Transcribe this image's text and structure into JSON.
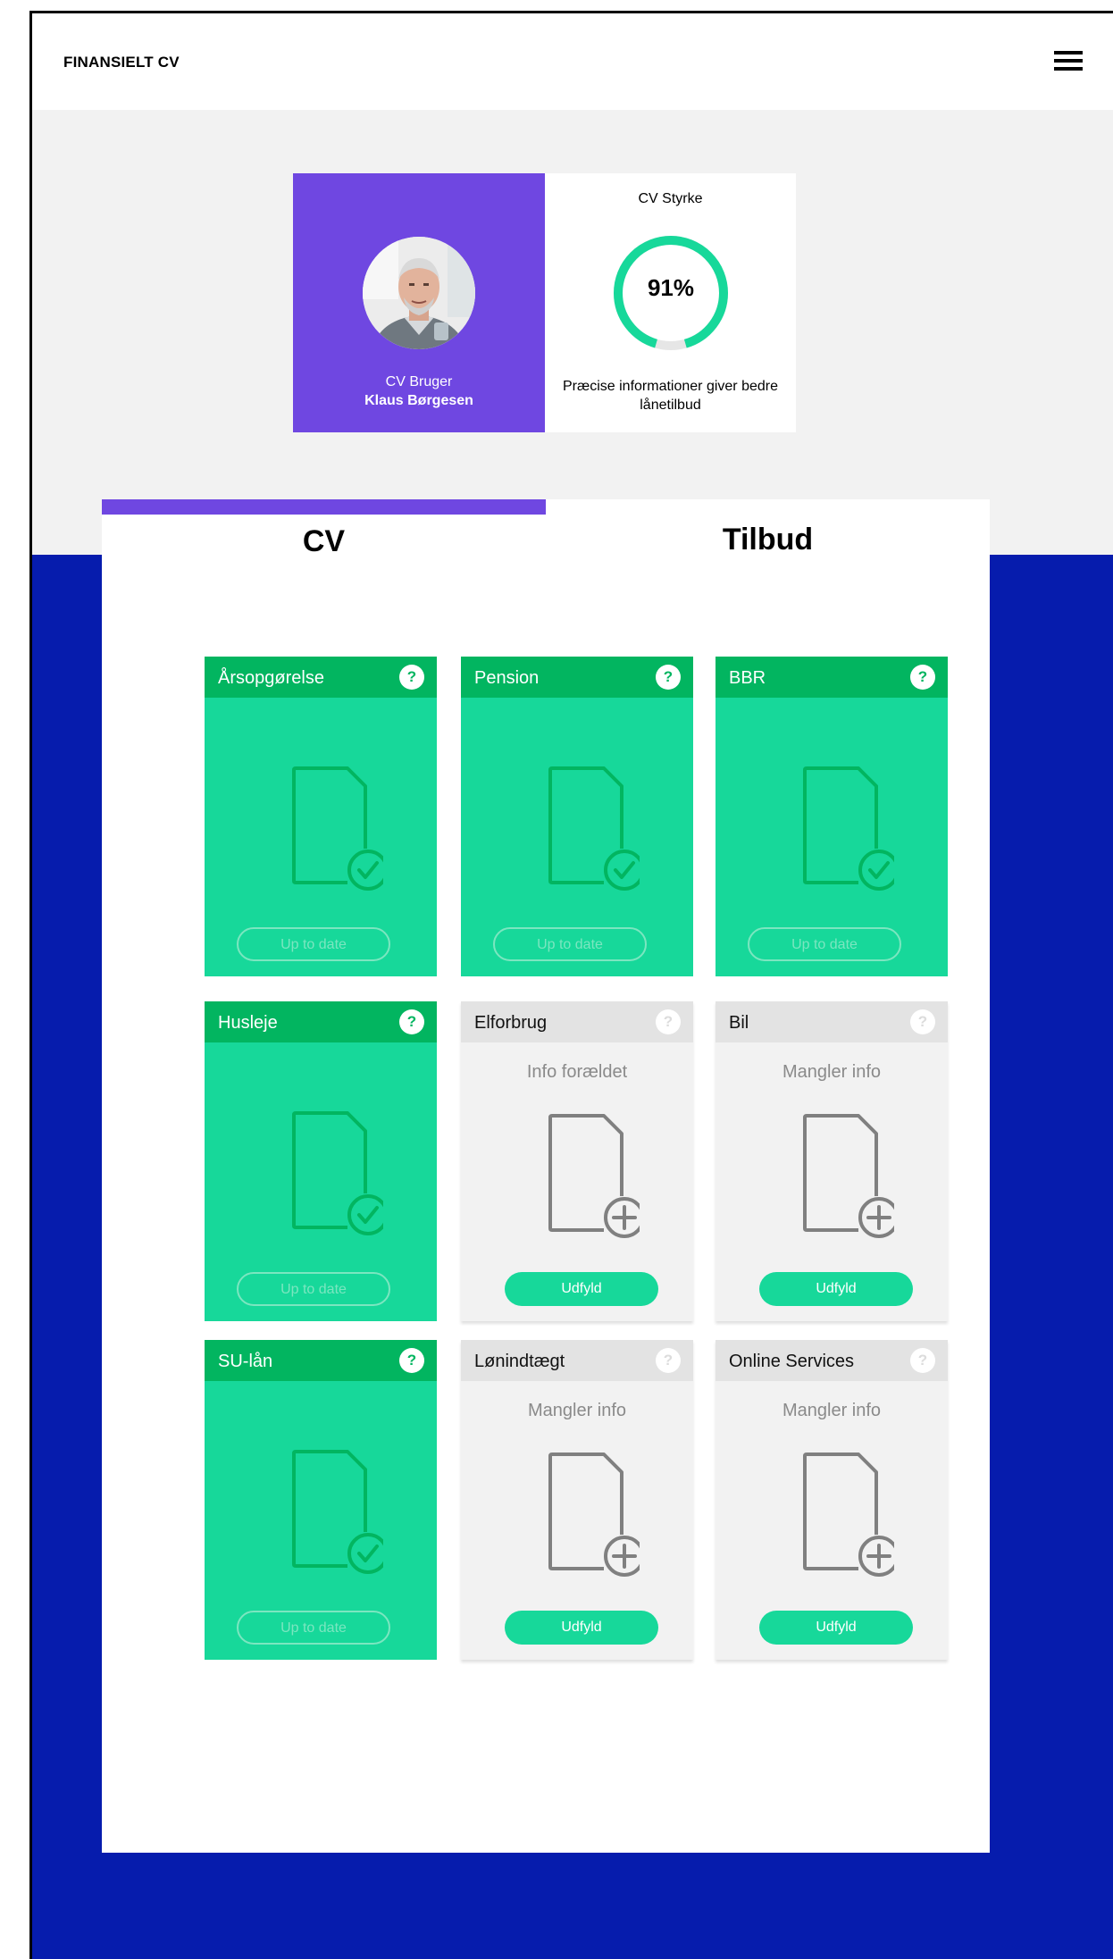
{
  "header": {
    "brand": "FINANSIELT CV",
    "menu_icon": "hamburger-icon"
  },
  "profile": {
    "role": "CV Bruger",
    "name": "Klaus Børgesen",
    "strength_title": "CV Styrke",
    "strength_value": "91%",
    "strength_fraction": 0.91,
    "note": "Præcise informationer giver bedre lånetilbud"
  },
  "tabs": [
    {
      "label": "CV",
      "active": true
    },
    {
      "label": "Tilbud",
      "active": false
    }
  ],
  "colors": {
    "purple": "#6f47e1",
    "navy": "#061cad",
    "green": "#17d89a",
    "dark_green": "#02b560",
    "grey": "#f2f2f2"
  },
  "cards": [
    {
      "title": "Årsopgørelse",
      "help": "?",
      "state": "complete",
      "icon": "document-check-icon",
      "button": "Up to date"
    },
    {
      "title": "Pension",
      "help": "?",
      "state": "complete",
      "icon": "document-check-icon",
      "button": "Up to date"
    },
    {
      "title": "BBR",
      "help": "?",
      "state": "complete",
      "icon": "document-check-icon",
      "button": "Up to date"
    },
    {
      "title": "Husleje",
      "help": "?",
      "state": "complete",
      "icon": "document-check-icon",
      "button": "Up to date"
    },
    {
      "title": "Elforbrug",
      "help": "?",
      "state": "missing",
      "status": "Info forældet",
      "icon": "document-add-icon",
      "button": "Udfyld"
    },
    {
      "title": "Bil",
      "help": "?",
      "state": "missing",
      "status": "Mangler info",
      "icon": "document-add-icon",
      "button": "Udfyld"
    },
    {
      "title": "SU-lån",
      "help": "?",
      "state": "complete",
      "icon": "document-check-icon",
      "button": "Up to date"
    },
    {
      "title": "Lønindtægt",
      "help": "?",
      "state": "missing",
      "status": "Mangler info",
      "icon": "document-add-icon",
      "button": "Udfyld"
    },
    {
      "title": "Online Services",
      "help": "?",
      "state": "missing",
      "status": "Mangler info",
      "icon": "document-add-icon",
      "button": "Udfyld"
    }
  ]
}
